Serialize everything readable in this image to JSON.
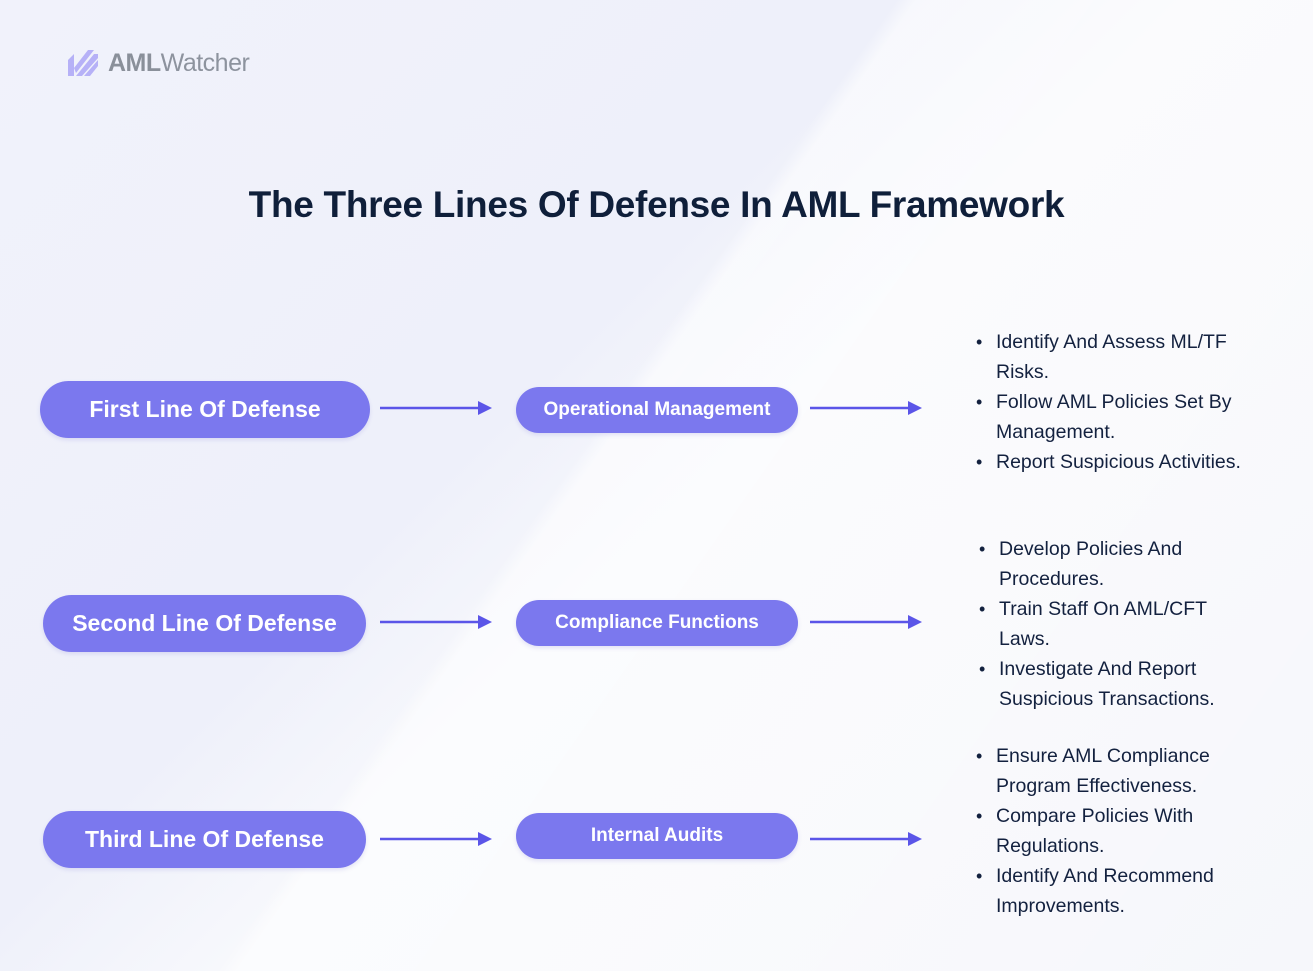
{
  "logo": {
    "bold": "AML",
    "light": "Watcher",
    "icon": "striped-logo-icon"
  },
  "title": "The Three Lines Of Defense In AML Framework",
  "colors": {
    "pill": "#7b78ee",
    "arrow": "#5b55e8",
    "title": "#0f1f3a",
    "text": "#13213f"
  },
  "rows": [
    {
      "line": "First Line Of Defense",
      "role": "Operational Management",
      "bullets": [
        "Identify And Assess ML/TF Risks.",
        "Follow AML Policies Set By Management.",
        "Report Suspicious Activities."
      ]
    },
    {
      "line": "Second Line Of Defense",
      "role": "Compliance Functions",
      "bullets": [
        "Develop Policies And Procedures.",
        "Train Staff On AML/CFT Laws.",
        "Investigate And Report Suspicious Transactions."
      ]
    },
    {
      "line": "Third Line Of Defense",
      "role": "Internal Audits",
      "bullets": [
        "Ensure AML Compliance Program Effectiveness.",
        "Compare Policies With Regulations.",
        "Identify And Recommend Improvements."
      ]
    }
  ]
}
